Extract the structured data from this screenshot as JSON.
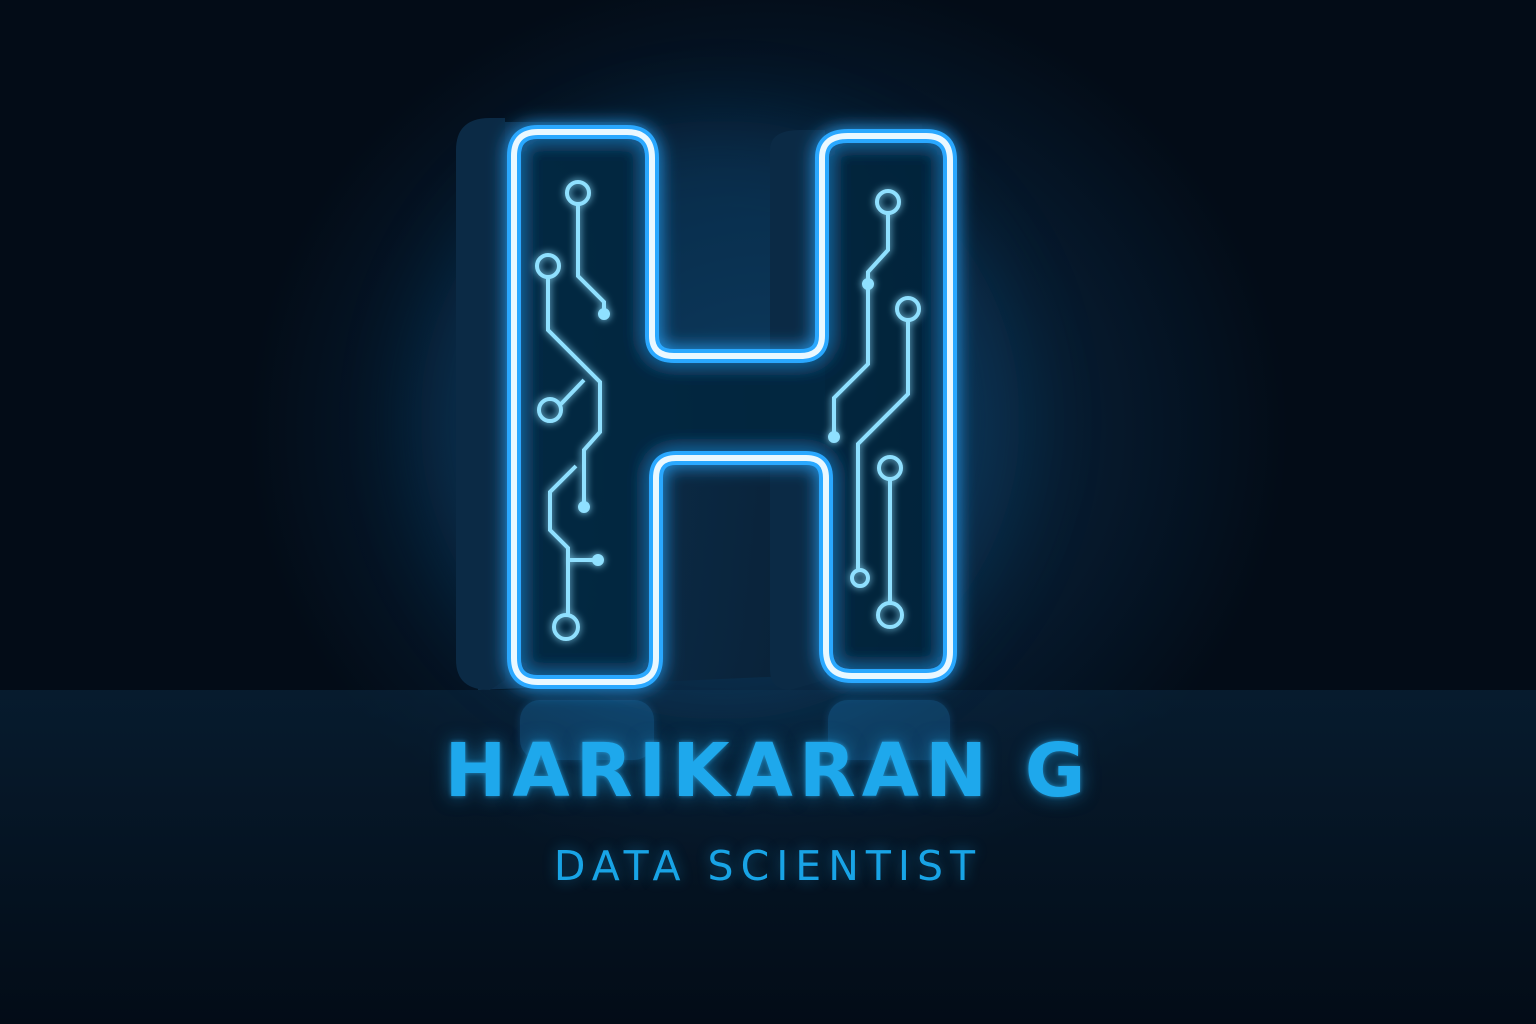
{
  "logo": {
    "letter_mark": "H",
    "motif": "circuit-board-traces",
    "colors": {
      "background": "#04101d",
      "neon_outline": "#eaf8ff",
      "neon_glow": "#2aa8ff",
      "circuit": "#8fe0ff",
      "body": "#0a2238"
    }
  },
  "title": {
    "name": "HARIKARAN G",
    "role": "DATA SCIENTIST"
  }
}
